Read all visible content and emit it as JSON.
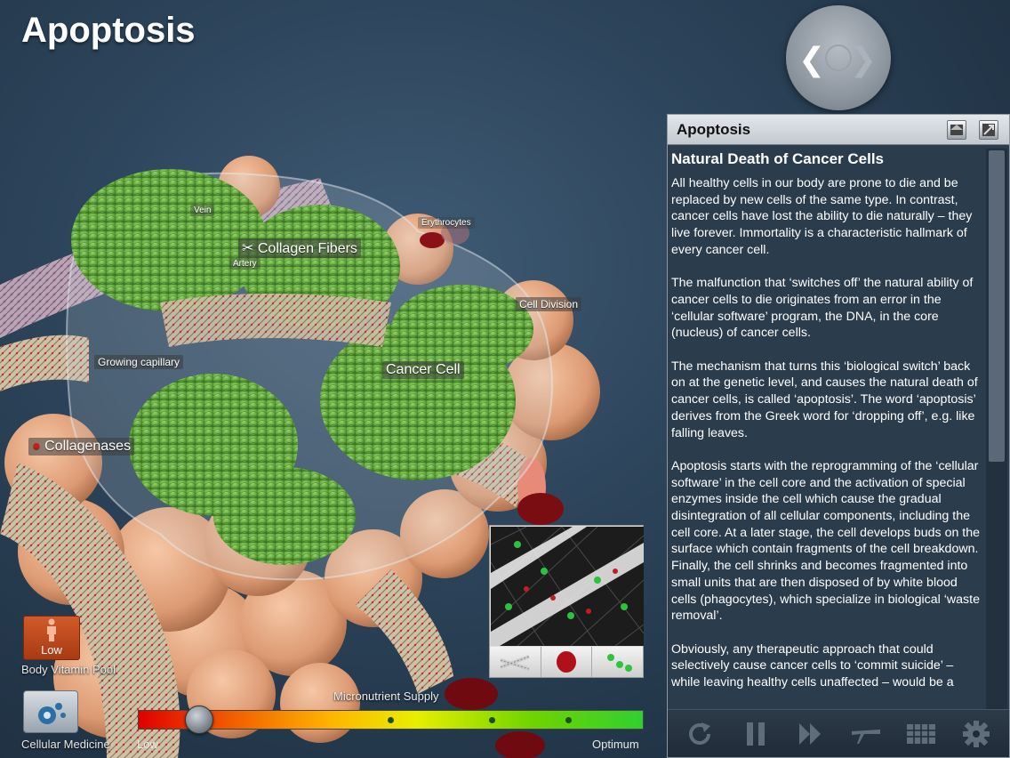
{
  "page_title": "Apoptosis",
  "scene_labels": {
    "vein": "Vein",
    "artery": "Artery",
    "erythrocytes": "Erythrocytes",
    "collagen_fibers": "Collagen Fibers",
    "cell_division": "Cell Division",
    "growing_capillary": "Growing capillary",
    "cancer_cell": "Cancer Cell",
    "collagenases": "Collagenases"
  },
  "controls": {
    "body_button_label": "Low",
    "body_caption": "Body Vitamin Pool",
    "medicine_caption": "Cellular Medicine",
    "supply_title": "Micronutrient Supply",
    "supply_low": "Low",
    "supply_optimum": "Optimum",
    "supply_level_percent": 12
  },
  "panel": {
    "title": "Apoptosis",
    "heading": "Natural Death of Cancer Cells",
    "paragraphs": [
      "All healthy cells in our body are prone to die and be replaced by new cells of the same type. In contrast, cancer cells have lost the ability to die naturally – they live forever. Immortality is a characteristic hallmark of every cancer cell.",
      "The malfunction that ‘switches off’ the natural ability of cancer cells to die originates from an error in the ‘cellular software’ program, the DNA, in the core (nucleus) of cancer cells.",
      "The mechanism that turns this ‘biological switch’ back on at the genetic level, and causes the natural death of cancer cells, is called ‘apoptosis’. The word ‘apoptosis’ derives from the Greek word for ‘dropping off’, e.g. like falling leaves.",
      "Apoptosis starts with the reprogramming of the ‘cellular software’ in the cell core and the activation of special enzymes inside the cell which cause the gradual disintegration of all cellular components, including the cell core. At a later stage, the cell develops buds on the surface which contain fragments of the cell breakdown. Finally, the cell shrinks and becomes fragmented into small units that are then disposed of by white blood cells (phagocytes), which specialize in biological ‘waste removal’.",
      "Obviously, any therapeutic approach that could selectively cause cancer cells to ‘commit suicide’ – while leaving healthy cells unaffected – would be a"
    ]
  },
  "colors": {
    "cancer_green": "#6fb24a",
    "panel_bg": "#2b3c4d",
    "accent_orange": "#c04a1e"
  }
}
